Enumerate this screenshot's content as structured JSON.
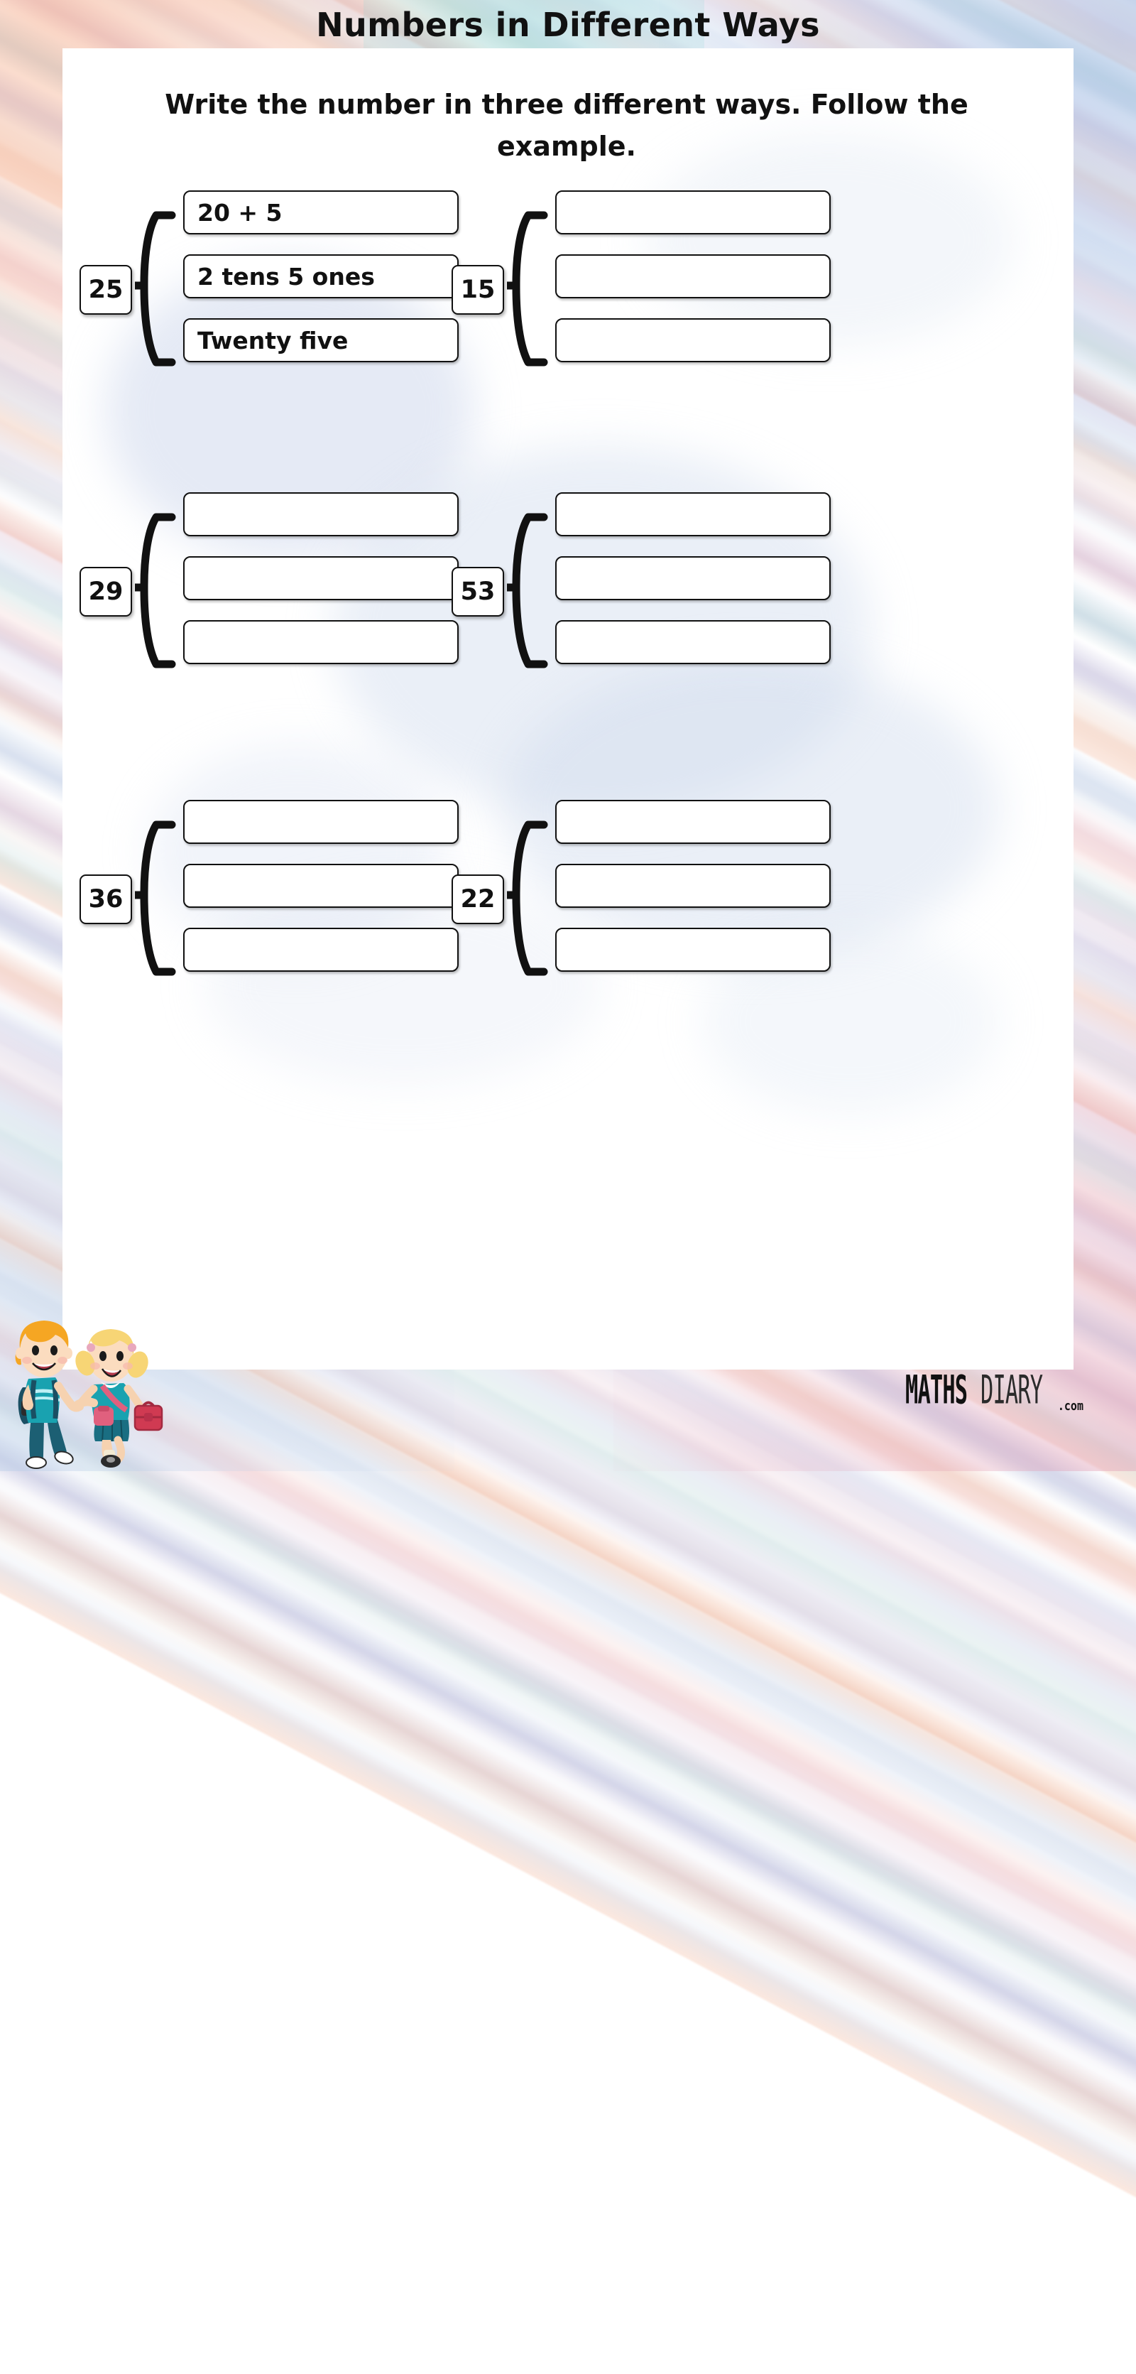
{
  "title": "Numbers in Different Ways",
  "instructions": "Write the number in three different ways. Follow the example.",
  "brand": {
    "part1": "MATHS",
    "part2": "DIARY",
    "suffix": ".com"
  },
  "artwork": {
    "kids": "two-school-kids-illustration",
    "background": "watercolor-diagonal-stripes-border"
  },
  "colors": {
    "ink": "#111111",
    "sheet": "#ffffff",
    "boy_shirt": "#1d9aa8",
    "girl_dress": "#1d9aa8",
    "boy_hair": "#f5a623",
    "girl_hair": "#f7d575",
    "satchel": "#e0607e",
    "lunchbox": "#d03a52"
  },
  "problems": [
    {
      "number": "25",
      "answers": [
        "20 + 5",
        "2 tens 5 ones",
        "Twenty five"
      ]
    },
    {
      "number": "15",
      "answers": [
        "",
        "",
        ""
      ]
    },
    {
      "number": "29",
      "answers": [
        "",
        "",
        ""
      ]
    },
    {
      "number": "53",
      "answers": [
        "",
        "",
        ""
      ]
    },
    {
      "number": "36",
      "answers": [
        "",
        "",
        ""
      ]
    },
    {
      "number": "22",
      "answers": [
        "",
        "",
        ""
      ]
    }
  ]
}
